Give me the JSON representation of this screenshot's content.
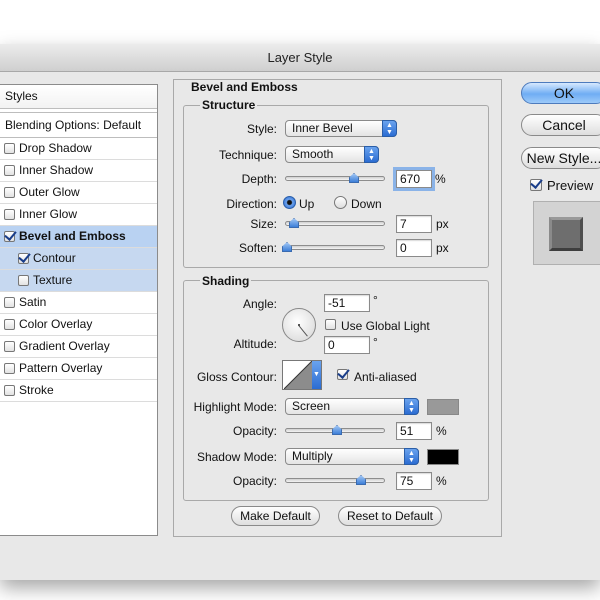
{
  "window": {
    "title": "Layer Style"
  },
  "styles_panel": {
    "header": "Styles",
    "blending": "Blending Options: Default",
    "items": [
      {
        "label": "Drop Shadow",
        "checked": false
      },
      {
        "label": "Inner Shadow",
        "checked": false
      },
      {
        "label": "Outer Glow",
        "checked": false
      },
      {
        "label": "Inner Glow",
        "checked": false
      },
      {
        "label": "Bevel and Emboss",
        "checked": true
      },
      {
        "label": "Contour",
        "checked": true
      },
      {
        "label": "Texture",
        "checked": false
      },
      {
        "label": "Satin",
        "checked": false
      },
      {
        "label": "Color Overlay",
        "checked": false
      },
      {
        "label": "Gradient Overlay",
        "checked": false
      },
      {
        "label": "Pattern Overlay",
        "checked": false
      },
      {
        "label": "Stroke",
        "checked": false
      }
    ]
  },
  "bevel": {
    "title": "Bevel and Emboss",
    "structure_title": "Structure",
    "style_label": "Style:",
    "style_value": "Inner Bevel",
    "technique_label": "Technique:",
    "technique_value": "Smooth",
    "depth_label": "Depth:",
    "depth_value": "670",
    "depth_unit": "%",
    "direction_label": "Direction:",
    "dir_up": "Up",
    "dir_down": "Down",
    "size_label": "Size:",
    "size_value": "7",
    "size_unit": "px",
    "soften_label": "Soften:",
    "soften_value": "0",
    "soften_unit": "px"
  },
  "shading": {
    "title": "Shading",
    "angle_label": "Angle:",
    "angle_value": "-51",
    "degree": "°",
    "global_light_label": "Use Global Light",
    "altitude_label": "Altitude:",
    "altitude_value": "0",
    "gloss_label": "Gloss Contour:",
    "anti_aliased_label": "Anti-aliased",
    "highlight_label": "Highlight Mode:",
    "highlight_value": "Screen",
    "highlight_color": "#999999",
    "opacity_label": "Opacity:",
    "highlight_opacity": "51",
    "percent": "%",
    "shadow_label": "Shadow Mode:",
    "shadow_value": "Multiply",
    "shadow_color": "#000000",
    "shadow_opacity": "75"
  },
  "footer": {
    "make_default": "Make Default",
    "reset_default": "Reset to Default"
  },
  "actions": {
    "ok": "OK",
    "cancel": "Cancel",
    "new_style": "New Style...",
    "preview": "Preview"
  }
}
